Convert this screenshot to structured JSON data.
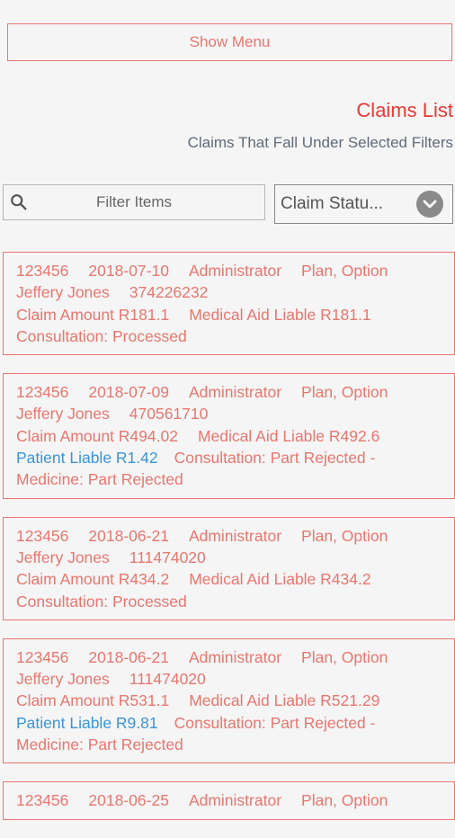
{
  "header": {
    "show_menu_label": "Show Menu",
    "title": "Claims List",
    "subtitle": "Claims That Fall Under Selected Filters"
  },
  "filters": {
    "search_placeholder": "Filter Items",
    "status_label": "Claim Statu..."
  },
  "icons": {
    "search": "search-icon",
    "dropdown": "chevron-down-icon"
  },
  "colors": {
    "accent": "#e8766e",
    "title_red": "#e53935",
    "patient_liable_blue": "#3a93d6"
  },
  "claims": [
    {
      "id": "123456",
      "date": "2018-07-10",
      "role": "Administrator",
      "plan": "Plan, Option",
      "patient": "Jeffery Jones",
      "number": "374226232",
      "claim_amount": "Claim Amount R181.1",
      "medical_aid_liable": "Medical Aid Liable R181.1",
      "patient_liable": "",
      "status_line1": "Consultation: Processed",
      "status_line2": ""
    },
    {
      "id": "123456",
      "date": "2018-07-09",
      "role": "Administrator",
      "plan": "Plan, Option",
      "patient": "Jeffery Jones",
      "number": "470561710",
      "claim_amount": "Claim Amount R494.02",
      "medical_aid_liable": "Medical Aid Liable R492.6",
      "patient_liable": "Patient Liable R1.42",
      "status_line1": "Consultation: Part Rejected -",
      "status_line2": "Medicine: Part Rejected"
    },
    {
      "id": "123456",
      "date": "2018-06-21",
      "role": "Administrator",
      "plan": "Plan, Option",
      "patient": "Jeffery Jones",
      "number": "111474020",
      "claim_amount": "Claim Amount R434.2",
      "medical_aid_liable": "Medical Aid Liable R434.2",
      "patient_liable": "",
      "status_line1": "Consultation: Processed",
      "status_line2": ""
    },
    {
      "id": "123456",
      "date": "2018-06-21",
      "role": "Administrator",
      "plan": "Plan, Option",
      "patient": "Jeffery Jones",
      "number": "111474020",
      "claim_amount": "Claim Amount R531.1",
      "medical_aid_liable": "Medical Aid Liable R521.29",
      "patient_liable": "Patient Liable R9.81",
      "status_line1": "Consultation: Part Rejected -",
      "status_line2": "Medicine: Part Rejected"
    },
    {
      "id": "123456",
      "date": "2018-06-25",
      "role": "Administrator",
      "plan": "Plan, Option",
      "patient": "",
      "number": "",
      "claim_amount": "",
      "medical_aid_liable": "",
      "patient_liable": "",
      "status_line1": "",
      "status_line2": ""
    }
  ]
}
